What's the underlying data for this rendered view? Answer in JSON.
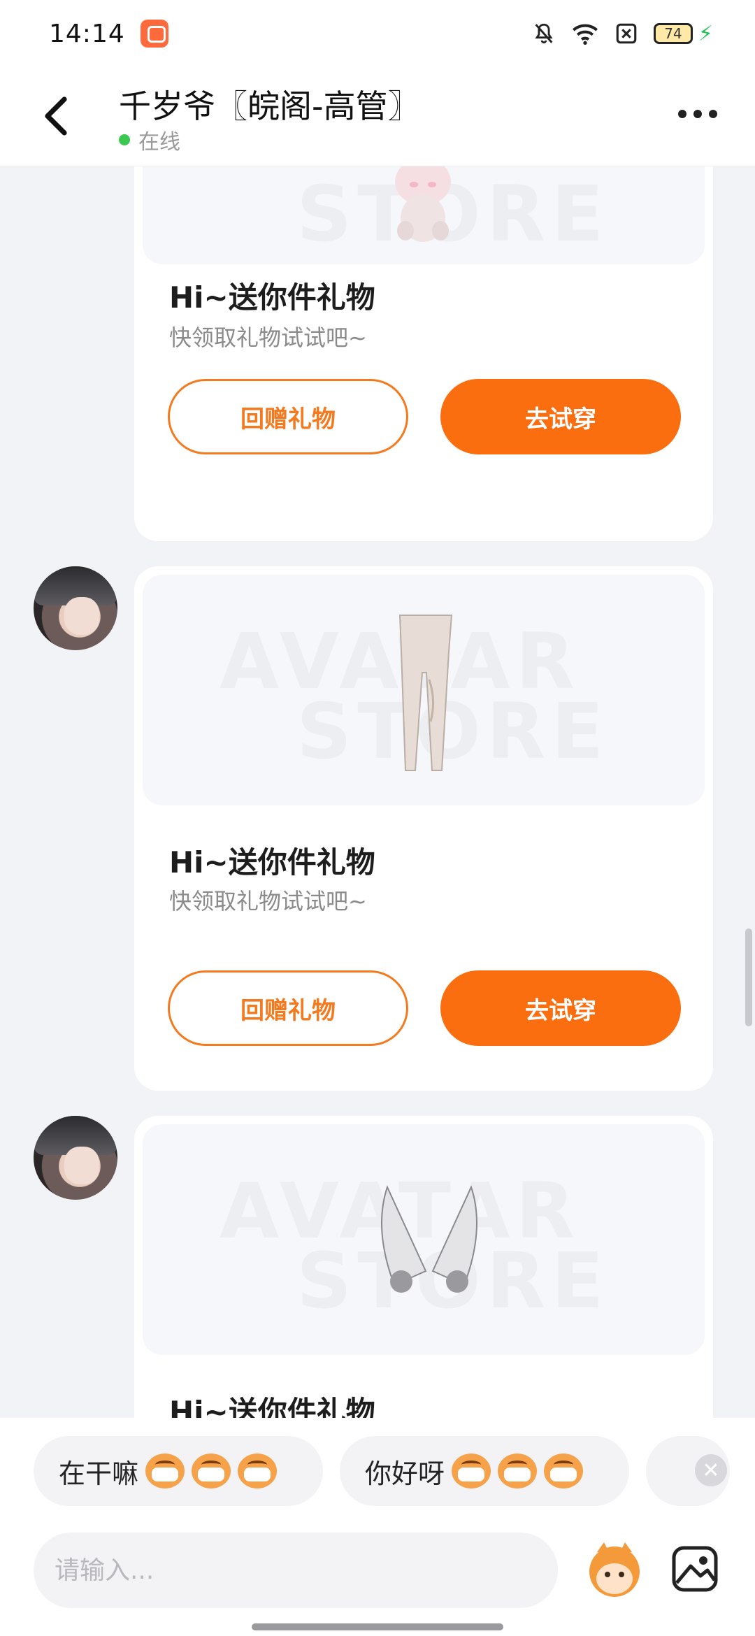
{
  "status_bar": {
    "time": "14:14",
    "battery": "74",
    "icons": [
      "app-badge-icon",
      "mute-bell-icon",
      "wifi-icon",
      "sim-x-icon",
      "battery-icon",
      "charging-icon"
    ]
  },
  "header": {
    "title": "千岁爷〖皖阁-高管〗",
    "status": "在线",
    "status_color": "#3cc753"
  },
  "messages": [
    {
      "item": "plush-toy",
      "title": "Hi~送你件礼物",
      "subtitle": "快领取礼物试试吧~",
      "return_label": "回赠礼物",
      "try_label": "去试穿"
    },
    {
      "item": "leggings",
      "title": "Hi~送你件礼物",
      "subtitle": "快领取礼物试试吧~",
      "return_label": "回赠礼物",
      "try_label": "去试穿",
      "watermark_top": "AVATAR",
      "watermark_bottom": "STORE"
    },
    {
      "item": "wings",
      "title": "Hi~送你件礼物",
      "watermark_top": "AVATAR",
      "watermark_bottom": "STORE"
    }
  ],
  "first_card_watermark": "STORE",
  "quick_replies": [
    {
      "text": "在干嘛"
    },
    {
      "text": "你好呀"
    }
  ],
  "input": {
    "placeholder": "请输入..."
  },
  "colors": {
    "accent": "#fa6e0f",
    "background": "#f2f3f7"
  }
}
